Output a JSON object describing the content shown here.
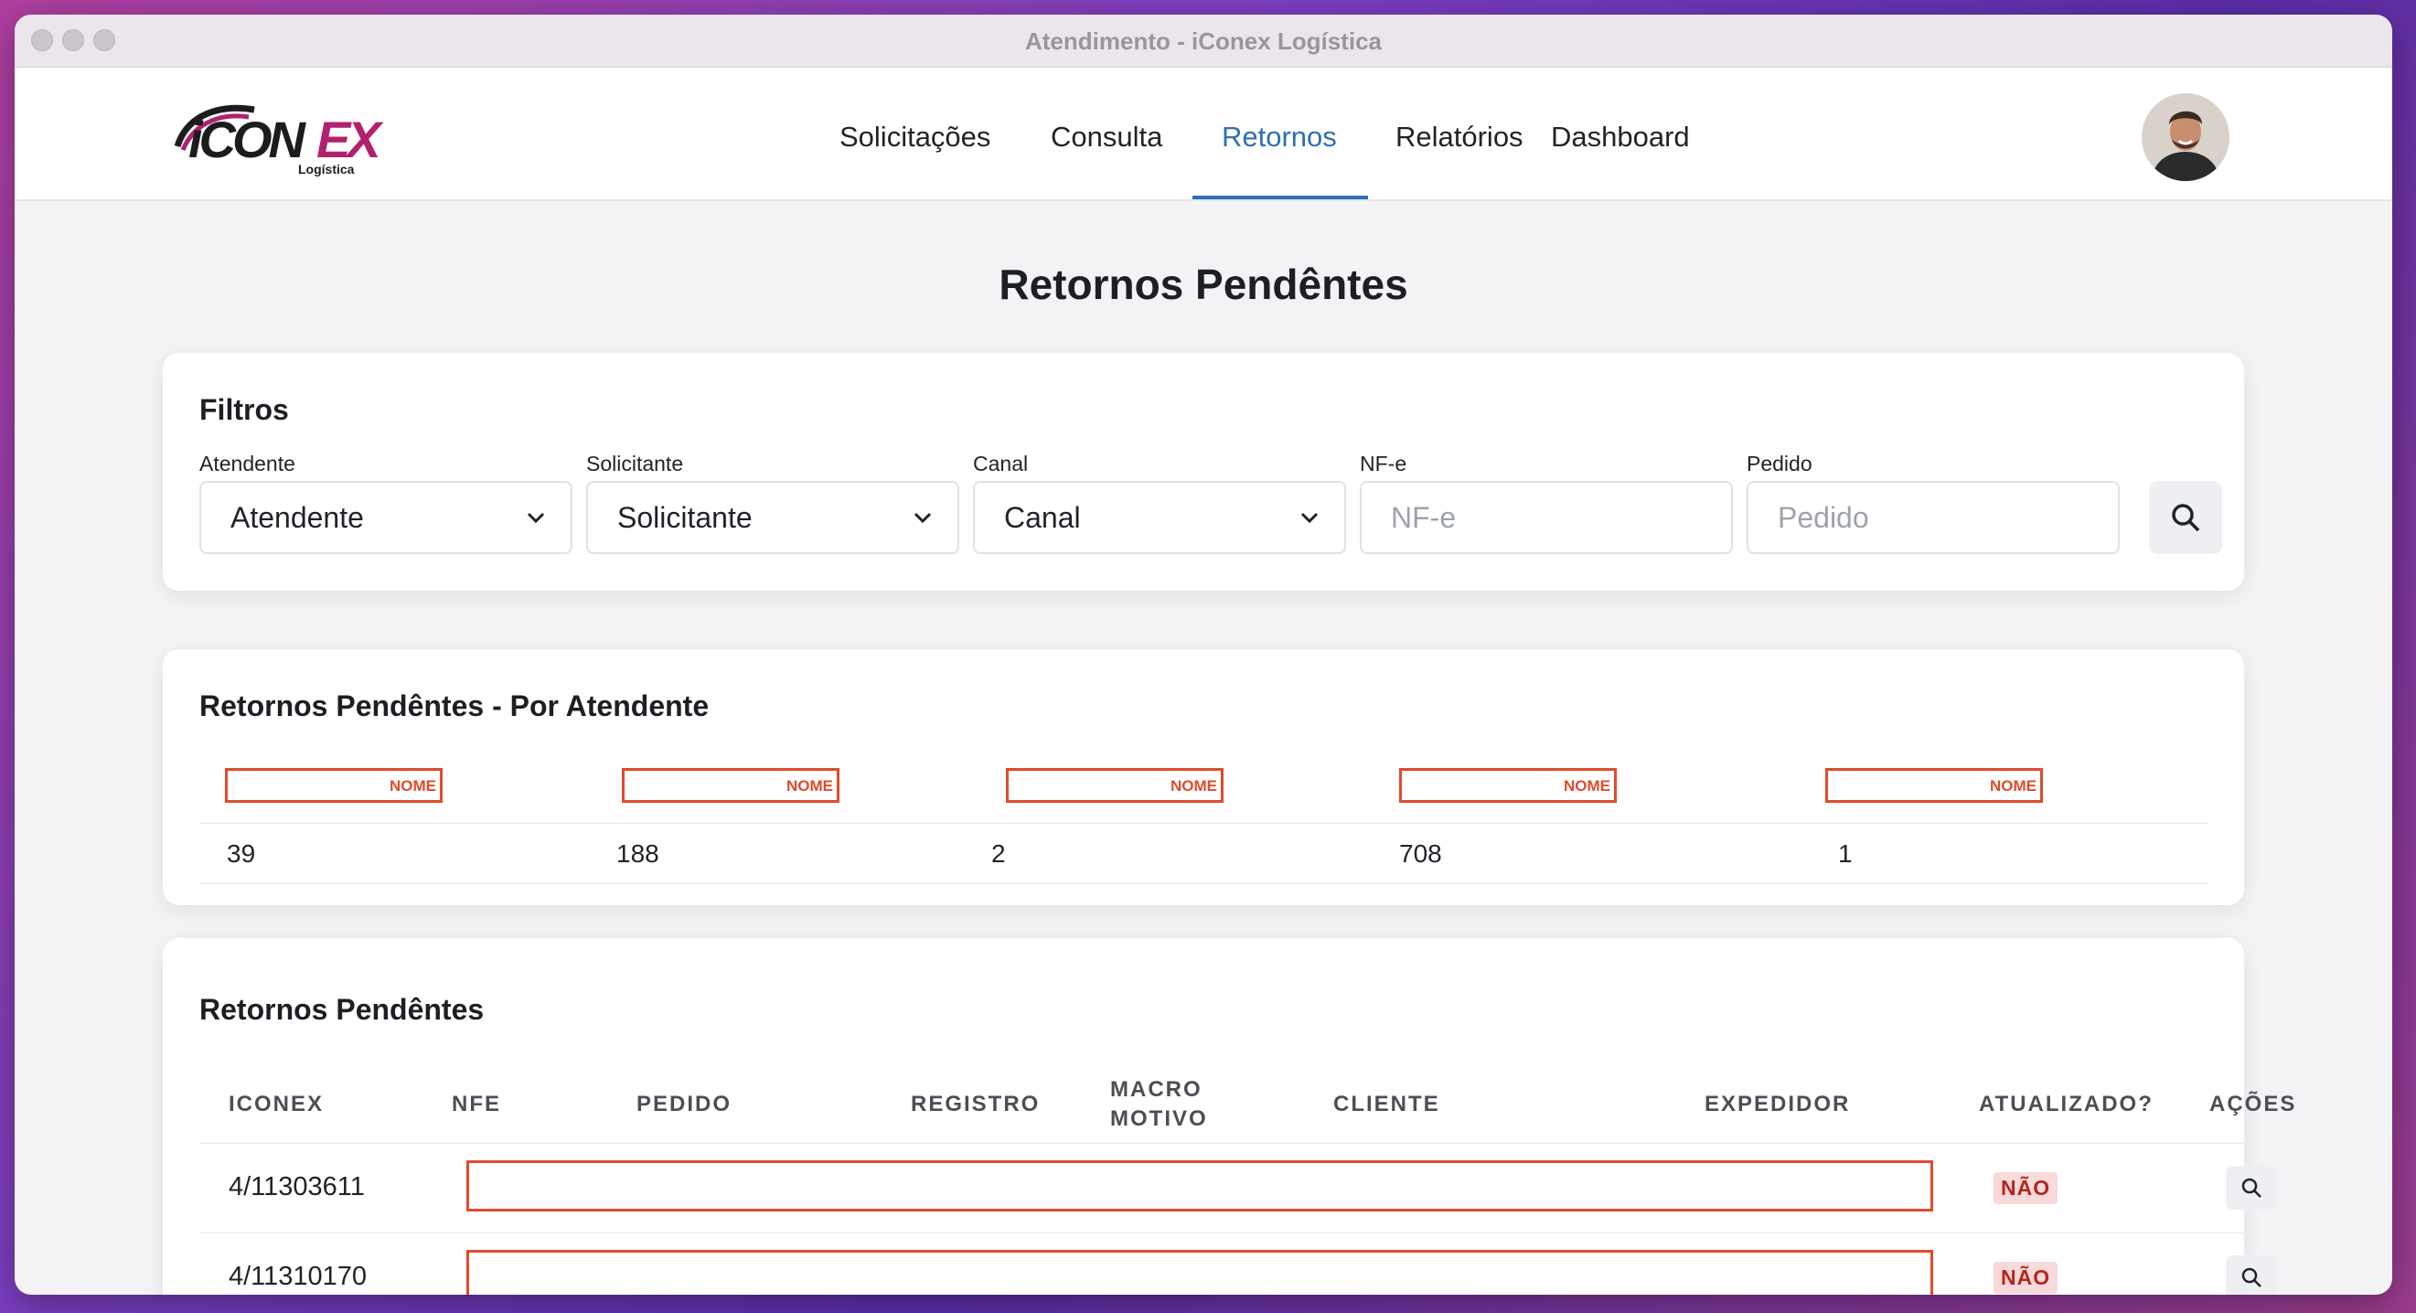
{
  "window": {
    "title": "Atendimento - iConex Logística"
  },
  "brand": {
    "name": "iCONEX",
    "subtitle": "Logística",
    "accent": "#b0226e",
    "dark": "#1c1c1c"
  },
  "nav": {
    "items": [
      {
        "label": "Solicitações"
      },
      {
        "label": "Consulta"
      },
      {
        "label": "Retornos"
      },
      {
        "label": "Relatórios"
      },
      {
        "label": "Dashboard"
      }
    ],
    "active": "Retornos",
    "active_color": "#2f6fb3"
  },
  "page": {
    "title": "Retornos Pendêntes"
  },
  "filters": {
    "title": "Filtros",
    "atendente": {
      "label": "Atendente",
      "value": "Atendente"
    },
    "solicitante": {
      "label": "Solicitante",
      "value": "Solicitante"
    },
    "canal": {
      "label": "Canal",
      "value": "Canal"
    },
    "nfe": {
      "label": "NF-e",
      "placeholder": "NF-e"
    },
    "pedido": {
      "label": "Pedido",
      "placeholder": "Pedido"
    },
    "search_icon": "search-icon"
  },
  "summary": {
    "title": "Retornos Pendêntes - Por Atendente",
    "columns": [
      {
        "name": "NOME",
        "value": "39"
      },
      {
        "name": "NOME",
        "value": "188"
      },
      {
        "name": "NOME",
        "value": "2"
      },
      {
        "name": "NOME",
        "value": "708"
      },
      {
        "name": "NOME",
        "value": "1"
      }
    ]
  },
  "table": {
    "title": "Retornos Pendêntes",
    "headers": {
      "iconex": "ICONEX",
      "nfe": "NFE",
      "pedido": "PEDIDO",
      "registro": "REGISTRO",
      "macro_motivo_1": "MACRO",
      "macro_motivo_2": "MOTIVO",
      "cliente": "CLIENTE",
      "expedidor": "EXPEDIDOR",
      "atualizado": "ATUALIZADO?",
      "acoes": "AÇÕES"
    },
    "rows": [
      {
        "iconex": "4/11303611",
        "atualizado": "NÃO"
      },
      {
        "iconex": "4/11310170",
        "atualizado": "NÃO"
      }
    ],
    "status_color": "#b3261e",
    "redaction_color": "#e14b2b"
  }
}
